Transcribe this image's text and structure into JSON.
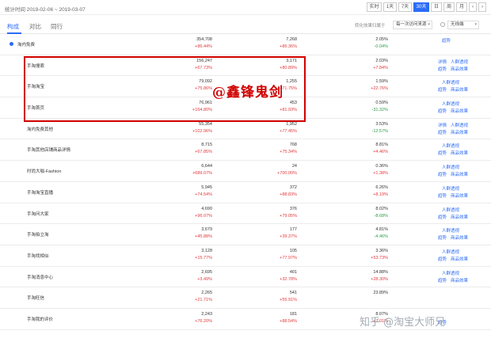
{
  "header": {
    "stat_time": "统计时间 2019-02-06 ~ 2019-03-07",
    "ranges": [
      "实时",
      "1天",
      "7天",
      "30天",
      "日",
      "周",
      "月"
    ],
    "active_range": "30天"
  },
  "tabs": [
    {
      "label": "构成",
      "active": true
    },
    {
      "label": "对比",
      "active": false
    },
    {
      "label": "同行",
      "active": false
    }
  ],
  "controls": {
    "convert_label": "转化效果归属于",
    "convert_value": "每一次访问来源",
    "device_value": "无线端"
  },
  "colors": {
    "accent": "#2c6cf6",
    "up": "#e4393c",
    "down": "#2a9d4a",
    "highlight_box": "#d00000"
  },
  "rows": [
    {
      "name": "淘内免费",
      "v1": "354,708",
      "c1": "+86.44%",
      "v2": "7,268",
      "c2": "+86.36%",
      "v3": "2.05%",
      "c3": "-0.04%",
      "c3dir": "down",
      "acts": [
        "",
        "趋势",
        "",
        ""
      ]
    },
    {
      "name": "手淘搜索",
      "v1": "156,247",
      "c1": "+67.73%",
      "v2": "3,171",
      "c2": "+80.89%",
      "v3": "2.03%",
      "c3": "+7.84%",
      "c3dir": "up",
      "acts": [
        "详情",
        "人群透视",
        "趋势",
        "商品效果"
      ]
    },
    {
      "name": "手淘淘宝",
      "v1": "79,092",
      "c1": "+75.86%",
      "v2": "1,255",
      "c2": "+71.75%",
      "v3": "1.59%",
      "c3": "+22.76%",
      "c3dir": "up",
      "acts": [
        "",
        "人群透视",
        "趋势",
        "商品效果"
      ]
    },
    {
      "name": "手淘首页",
      "v1": "76,961",
      "c1": "+164.80%",
      "v2": "453",
      "c2": "+81.93%",
      "v3": "0.59%",
      "c3": "-31.32%",
      "c3dir": "down",
      "acts": [
        "",
        "人群透视",
        "趋势",
        "商品效果"
      ]
    },
    {
      "name": "淘内免费其他",
      "v1": "55,354",
      "c1": "+102.96%",
      "v2": "1,952",
      "c2": "+77.45%",
      "v3": "3.53%",
      "c3": "-12.57%",
      "c3dir": "down",
      "acts": [
        "详情",
        "人群透视",
        "趋势",
        "商品效果"
      ]
    },
    {
      "name": "手淘其他店铺商品详情",
      "v1": "8,715",
      "c1": "+67.85%",
      "v2": "768",
      "c2": "+75.34%",
      "v3": "8.81%",
      "c3": "+4.46%",
      "c3dir": "up",
      "acts": [
        "",
        "人群透视",
        "趋势",
        "商品效果"
      ]
    },
    {
      "name": "时尚大咖-Fashion",
      "v1": "6,644",
      "c1": "+689.07%",
      "v2": "24",
      "c2": "+700.00%",
      "v3": "0.36%",
      "c3": "+1.38%",
      "c3dir": "up",
      "acts": [
        "",
        "人群透视",
        "趋势",
        "商品效果"
      ]
    },
    {
      "name": "手淘淘宝直播",
      "v1": "5,945",
      "c1": "+74.54%",
      "v2": "372",
      "c2": "+88.83%",
      "v3": "6.26%",
      "c3": "+8.19%",
      "c3dir": "up",
      "acts": [
        "",
        "人群透视",
        "趋势",
        "商品效果"
      ]
    },
    {
      "name": "手淘问大家",
      "v1": "4,690",
      "c1": "+96.07%",
      "v2": "376",
      "c2": "+79.05%",
      "v3": "8.02%",
      "c3": "-8.68%",
      "c3dir": "down",
      "acts": [
        "",
        "人群透视",
        "趋势",
        "商品效果"
      ]
    },
    {
      "name": "手淘拍立淘",
      "v1": "3,679",
      "c1": "+45.88%",
      "v2": "177",
      "c2": "+39.37%",
      "v3": "4.81%",
      "c3": "-4.46%",
      "c3dir": "down",
      "acts": [
        "",
        "人群透视",
        "趋势",
        "商品效果"
      ]
    },
    {
      "name": "手淘找相似",
      "v1": "3,128",
      "c1": "+15.77%",
      "v2": "105",
      "c2": "+77.97%",
      "v3": "3.36%",
      "c3": "+53.73%",
      "c3dir": "up",
      "acts": [
        "",
        "人群透视",
        "趋势",
        "商品效果"
      ]
    },
    {
      "name": "手淘消息中心",
      "v1": "2,695",
      "c1": "+3.49%",
      "v2": "401",
      "c2": "+32.78%",
      "v3": "14.88%",
      "c3": "+28.30%",
      "c3dir": "up",
      "acts": [
        "",
        "人群透视",
        "趋势",
        "商品效果"
      ]
    },
    {
      "name": "手淘旺信",
      "v1": "2,265",
      "c1": "+21.71%",
      "v2": "541",
      "c2": "+55.91%",
      "v3": "23.89%",
      "c3": "",
      "c3dir": "up",
      "acts": [
        "",
        "",
        "",
        ""
      ]
    },
    {
      "name": "手淘我的评价",
      "v1": "2,243",
      "c1": "+76.20%",
      "v2": "181",
      "c2": "+88.54%",
      "v3": "8.07%",
      "c3": "+7.01%",
      "c3dir": "up",
      "acts": [
        "",
        "",
        "趋势",
        ""
      ]
    }
  ],
  "watermarks": {
    "box_text": "@鑫锋鬼剑",
    "corner_text": "知乎 @淘宝大师兄"
  }
}
